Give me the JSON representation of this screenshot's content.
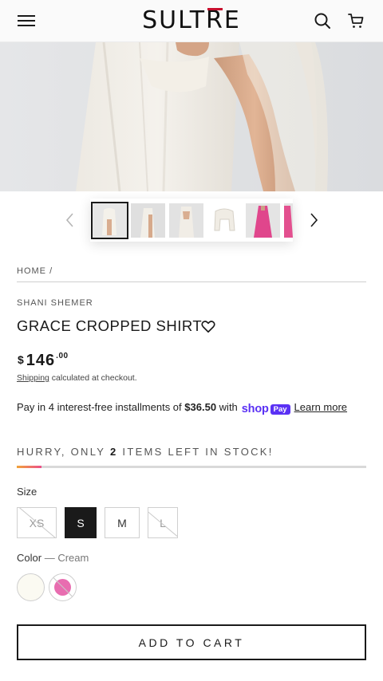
{
  "header": {
    "logo_prefix": "SULT",
    "logo_accent": "R",
    "logo_suffix": "E",
    "icons": [
      "menu-icon",
      "search-icon",
      "cart-icon"
    ]
  },
  "gallery": {
    "thumbnails": [
      {
        "name": "thumb-1",
        "active": true
      },
      {
        "name": "thumb-2",
        "active": false
      },
      {
        "name": "thumb-3",
        "active": false
      },
      {
        "name": "thumb-4",
        "active": false
      },
      {
        "name": "thumb-5",
        "active": false
      },
      {
        "name": "thumb-6",
        "active": false
      }
    ],
    "prev_icon": "chevron-left-icon",
    "next_icon": "chevron-right-icon"
  },
  "breadcrumb": {
    "home": "HOME",
    "separator": "/"
  },
  "product": {
    "vendor": "SHANI SHEMER",
    "title": "GRACE CROPPED SHIRT",
    "currency": "$",
    "price_whole": "146",
    "price_cents": ".00",
    "shipping_link": "Shipping",
    "shipping_text": "calculated at checkout."
  },
  "installments": {
    "prefix": "Pay in 4 interest-free installments of",
    "amount": "$36.50",
    "with": "with",
    "shop": "shop",
    "pay": "Pay",
    "learn_more": "Learn more"
  },
  "stock": {
    "prefix": "HURRY, ONLY",
    "count": "2",
    "suffix": "ITEMS LEFT IN STOCK!",
    "level_fraction": 0.07,
    "colors": {
      "start": "#f0a43a",
      "end": "#ec4f8a"
    }
  },
  "size": {
    "label": "Size",
    "options": [
      {
        "label": "XS",
        "state": "soldout"
      },
      {
        "label": "S",
        "state": "selected"
      },
      {
        "label": "M",
        "state": "available"
      },
      {
        "label": "L",
        "state": "soldout"
      }
    ]
  },
  "color": {
    "label": "Color",
    "separator": "—",
    "selected": "Cream",
    "swatches": [
      {
        "name": "cream",
        "hex": "#fbfaf2",
        "state": "selected"
      },
      {
        "name": "pink",
        "hex": "#e86db0",
        "state": "soldout"
      }
    ]
  },
  "cart": {
    "add_label": "ADD TO CART"
  }
}
